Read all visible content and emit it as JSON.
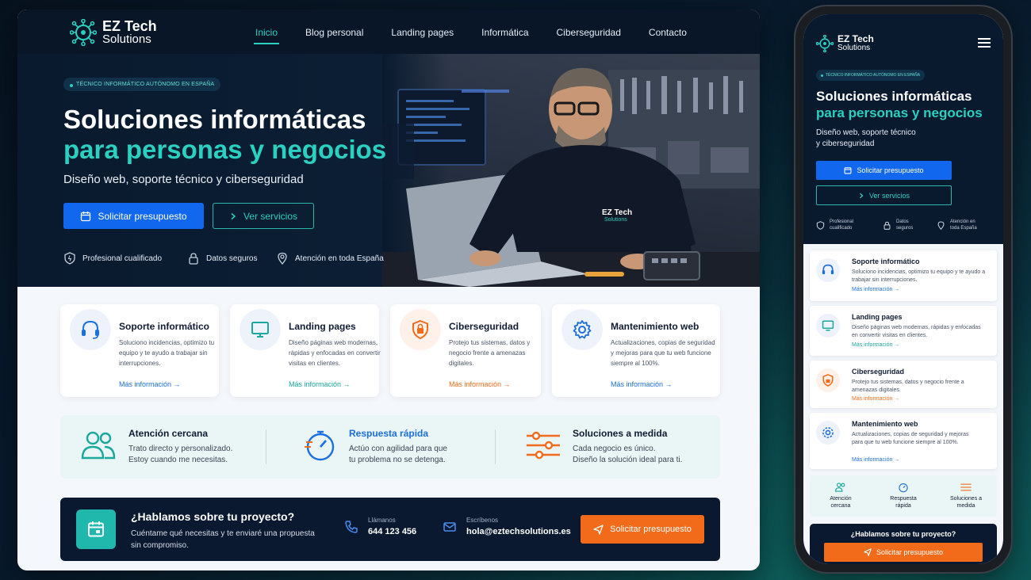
{
  "brand": {
    "name_line1": "EZ Tech",
    "name_line2": "Solutions"
  },
  "nav": {
    "items": [
      "Inicio",
      "Blog personal",
      "Landing pages",
      "Informática",
      "Ciberseguridad",
      "Contacto"
    ],
    "active": "Inicio"
  },
  "hero": {
    "badge": "TÉCNICO INFORMÁTICO AUTÓNOMO EN ESPAÑA",
    "title_line1": "Soluciones informáticas",
    "title_line2": "para personas y negocios",
    "subtitle": "Diseño web, soporte técnico y ciberseguridad",
    "primary_button": "Solicitar presupuesto",
    "secondary_button": "Ver servicios",
    "trust": [
      "Profesional cualificado",
      "Datos seguros",
      "Atención en toda España"
    ],
    "shirt_logo_line1": "EZ Tech",
    "shirt_logo_line2": "Solutions"
  },
  "services": [
    {
      "title": "Soporte informático",
      "desc": "Soluciono incidencias, optimizo tu equipo y te ayudo a trabajar sin interrupciones.",
      "link": "Más información",
      "icon": "headset-icon",
      "color": "#1b6fe0"
    },
    {
      "title": "Landing pages",
      "desc": "Diseño páginas web modernas, rápidas y enfocadas en convertir visitas en clientes.",
      "link": "Más información",
      "icon": "monitor-icon",
      "color": "#18a89c"
    },
    {
      "title": "Ciberseguridad",
      "desc": "Protejo tus sistemas, datos y negocio frente a amenazas digitales.",
      "link": "Más información",
      "icon": "shield-lock-icon",
      "color": "#f26b1a"
    },
    {
      "title": "Mantenimiento web",
      "desc": "Actualizaciones, copias de seguridad y mejoras para que tu web funcione siempre al 100%.",
      "link": "Más información",
      "icon": "gear-icon",
      "color": "#1b6fe0"
    }
  ],
  "features": [
    {
      "title": "Atención cercana",
      "desc_line1": "Trato directo y personalizado.",
      "desc_line2": "Estoy cuando me necesitas.",
      "icon": "users-icon",
      "color": "#18a89c"
    },
    {
      "title": "Respuesta rápida",
      "desc_line1": "Actúo con agilidad para que",
      "desc_line2": "tu problema no se detenga.",
      "icon": "stopwatch-icon",
      "color": "#1b6fe0"
    },
    {
      "title": "Soluciones a medida",
      "desc_line1": "Cada negocio es único.",
      "desc_line2": "Diseño la solución ideal para ti.",
      "icon": "sliders-icon",
      "color": "#f26b1a"
    }
  ],
  "cta": {
    "title": "¿Hablamos sobre tu proyecto?",
    "desc": "Cuéntame qué necesitas y te enviaré una propuesta sin compromiso.",
    "phone_label": "Llámanos",
    "phone": "644 123 456",
    "email_label": "Escríbenos",
    "email": "hola@eztechsolutions.es",
    "button": "Solicitar presupuesto"
  },
  "mobile": {
    "subtitle_line1": "Diseño web, soporte técnico",
    "subtitle_line2": "y ciberseguridad",
    "trust": [
      [
        "Profesional",
        "cualificado"
      ],
      [
        "Datos",
        "seguros"
      ],
      [
        "Atención en",
        "toda España"
      ]
    ],
    "services": [
      {
        "title": "Soporte informático",
        "desc": "Soluciono incidencias, optimizo tu equipo y te ayudo a trabajar sin interrupciones."
      },
      {
        "title": "Landing pages",
        "desc": "Diseño páginas web modernas, rápidas y enfocadas en convertir visitas en clientes."
      },
      {
        "title": "Ciberseguridad",
        "desc": "Protejo tus sistemas, datos y negocio frente a amenazas digitales."
      },
      {
        "title": "Mantenimiento web",
        "desc": "Actualizaciones, copias de seguridad y mejoras para que tu web funcione siempre al 100%."
      }
    ],
    "features": [
      [
        "Atención",
        "cercana"
      ],
      [
        "Respuesta",
        "rápida"
      ],
      [
        "Soluciones a",
        "medida"
      ]
    ]
  }
}
